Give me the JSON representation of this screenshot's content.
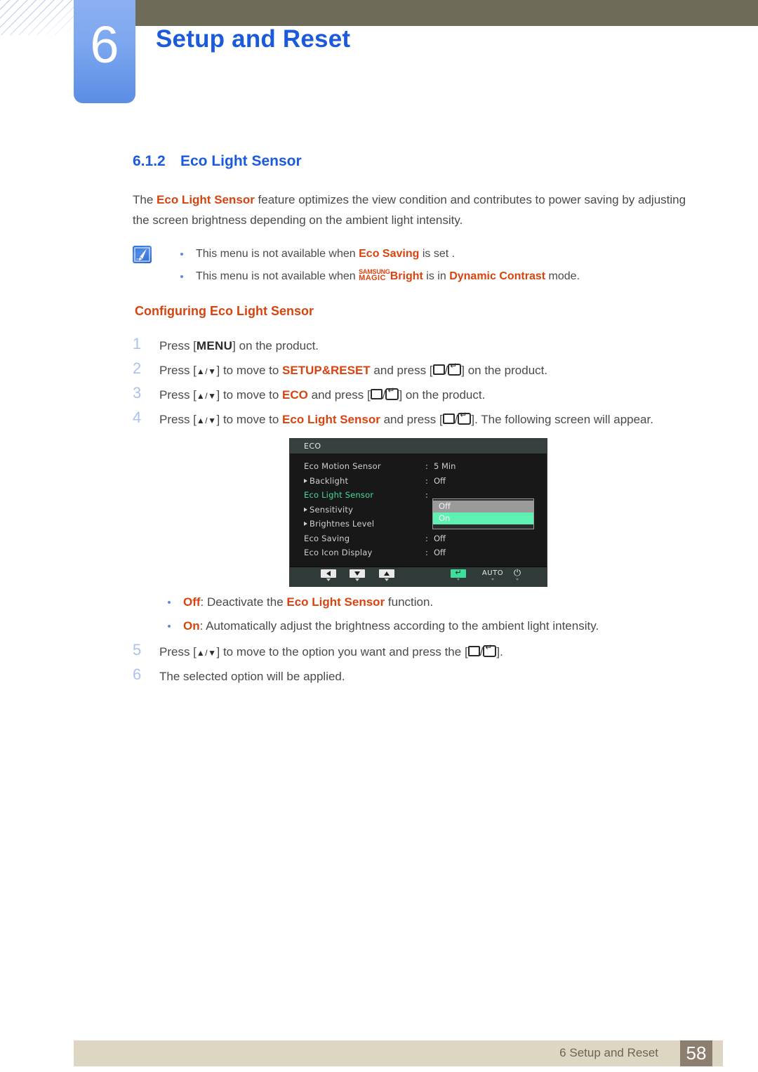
{
  "header": {
    "chapter_number": "6",
    "chapter_title": "Setup and Reset"
  },
  "section": {
    "number": "6.1.2",
    "title": "Eco Light Sensor",
    "intro_lead": "The ",
    "intro_term": "Eco Light Sensor",
    "intro_rest": " feature optimizes the view condition and contributes to power saving by adjusting the screen brightness depending on the ambient light intensity."
  },
  "note": {
    "icon": "note-pencil-icon",
    "items": [
      {
        "pre": "This menu is not available when ",
        "term1": "Eco Saving",
        "post": " is set ."
      },
      {
        "pre": "This menu is not available when ",
        "magic_top": "SAMSUNG",
        "magic_bottom": "MAGIC",
        "magic_word": "Bright",
        "mid": " is in ",
        "term2": "Dynamic Contrast",
        "post": " mode."
      }
    ]
  },
  "configuring": {
    "heading": "Configuring Eco Light Sensor",
    "steps": [
      {
        "num": "1",
        "a": "Press [",
        "key": "MENU",
        "b": "] on the product."
      },
      {
        "num": "2",
        "a": "Press [",
        "arrows": "▲/▼",
        "b": "] to move to ",
        "term": "SETUP&RESET",
        "c": " and press [",
        "d": "] on the product."
      },
      {
        "num": "3",
        "a": "Press [",
        "arrows": "▲/▼",
        "b": "] to move to ",
        "term": "ECO",
        "c": " and press [",
        "d": "] on the product."
      },
      {
        "num": "4",
        "a": "Press [",
        "arrows": "▲/▼",
        "b": "] to move to ",
        "term": "Eco Light Sensor",
        "c": " and press [",
        "d": "]. The following screen will appear."
      },
      {
        "num": "5",
        "a": "Press [",
        "arrows": "▲/▼",
        "b": "] to move to the option you want and press the [",
        "d": "]."
      },
      {
        "num": "6",
        "a": "The selected option will be applied."
      }
    ]
  },
  "osd": {
    "title": "ECO",
    "rows": [
      {
        "label": "Eco Motion Sensor",
        "has_arrow": false,
        "colon": ":",
        "value": "5 Min",
        "selected": false
      },
      {
        "label": "Backlight",
        "has_arrow": true,
        "colon": ":",
        "value": "Off",
        "selected": false
      },
      {
        "label": "Eco Light Sensor",
        "has_arrow": false,
        "colon": ":",
        "value": "",
        "selected": true
      },
      {
        "label": "Sensitivity",
        "has_arrow": true,
        "colon": "",
        "value": "",
        "selected": false
      },
      {
        "label": "Brightnes Level",
        "has_arrow": true,
        "colon": "",
        "value": "",
        "selected": false
      },
      {
        "label": "Eco Saving",
        "has_arrow": false,
        "colon": ":",
        "value": "Off",
        "selected": false
      },
      {
        "label": "Eco Icon Display",
        "has_arrow": false,
        "colon": ":",
        "value": "Off",
        "selected": false
      }
    ],
    "popup": {
      "options": [
        "Off",
        "On"
      ],
      "highlighted": "On"
    },
    "footer_buttons": [
      {
        "name": "left-arrow-button",
        "glyph": "◀",
        "label": ""
      },
      {
        "name": "down-arrow-button",
        "glyph": "▼",
        "label": ""
      },
      {
        "name": "up-arrow-button",
        "glyph": "▲",
        "label": ""
      },
      {
        "name": "enter-button",
        "glyph": "↵",
        "label": ""
      },
      {
        "name": "auto-button",
        "glyph": "",
        "label": "AUTO"
      },
      {
        "name": "power-button",
        "glyph": "⏻",
        "label": ""
      }
    ]
  },
  "options": [
    {
      "term": "Off",
      "desc_pre": ": Deactivate the ",
      "desc_term": "Eco Light Sensor",
      "desc_post": " function."
    },
    {
      "term": "On",
      "desc_pre": ": Automatically adjust the brightness according to the ambient light intensity.",
      "desc_term": "",
      "desc_post": ""
    }
  ],
  "footer": {
    "text": "6 Setup and Reset",
    "page": "58"
  },
  "colors": {
    "accent_blue": "#1b5bdb",
    "accent_orange": "#d9430f",
    "header_olive": "#6e6b58",
    "chapter_blue": "#7ba6ef",
    "footer_beige": "#dcd6c2",
    "page_box": "#8c7f70",
    "osd_green": "#3fdd9b",
    "osd_popup_green": "#5ff0b4"
  }
}
